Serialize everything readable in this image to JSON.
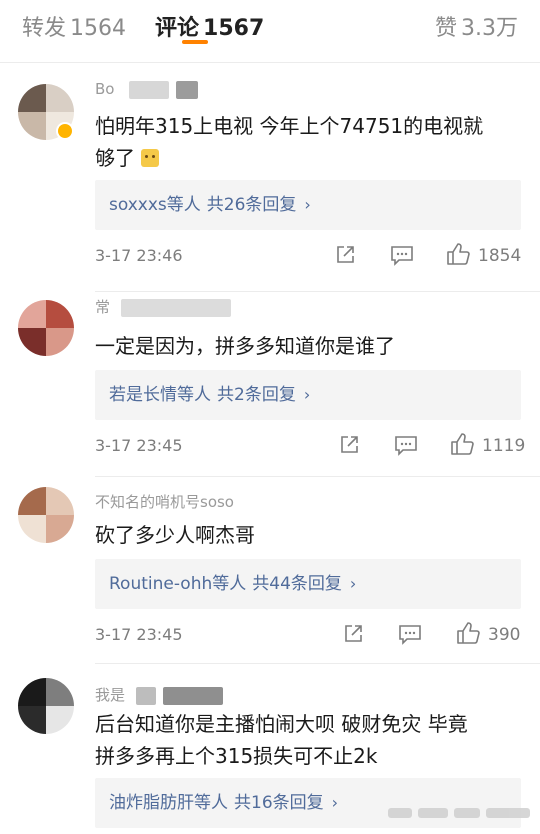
{
  "tabs": {
    "repost": {
      "label": "转发",
      "count": "1564"
    },
    "comments": {
      "label": "评论",
      "count": "1567"
    },
    "likes": {
      "label": "赞",
      "count": "3.3万"
    }
  },
  "comments": [
    {
      "username_partial": "Bo",
      "text_line1": "怕明年315上电视 今年上个74751的电视就",
      "text_line2": "够了",
      "reply_user": "soxxxs",
      "reply_suffix": "等人",
      "reply_count": "共26条回复",
      "time": "3-17 23:46",
      "likes": "1854"
    },
    {
      "username_partial": "常",
      "text_line1": "一定是因为，拼多多知道你是谁了",
      "reply_user": "若是长情",
      "reply_suffix": "等人",
      "reply_count": "共2条回复",
      "time": "3-17 23:45",
      "likes": "1119"
    },
    {
      "username_partial": "不知名的哨机号soso",
      "text_line1": "砍了多少人啊杰哥",
      "reply_user": "Routine-ohh",
      "reply_suffix": "等人",
      "reply_count": "共44条回复",
      "time": "3-17 23:45",
      "likes": "390"
    },
    {
      "username_partial": "我是",
      "text_line1": "后台知道你是主播怕闹大呗 破财免灾 毕竟",
      "text_line2": "拼多多再上个315损失可不止2k",
      "reply_user": "油炸脂肪肝",
      "reply_suffix": "等人",
      "reply_count": "共16条回复"
    }
  ],
  "icons": {
    "share": "share-icon",
    "comment": "comment-icon",
    "like": "thumbs-up-icon",
    "reply_arrow": "chevron-right-icon"
  },
  "colors": {
    "accent": "#ff8200",
    "link": "#506b9a",
    "muted": "#7d7d7d",
    "reply_bg": "#f4f4f4"
  }
}
